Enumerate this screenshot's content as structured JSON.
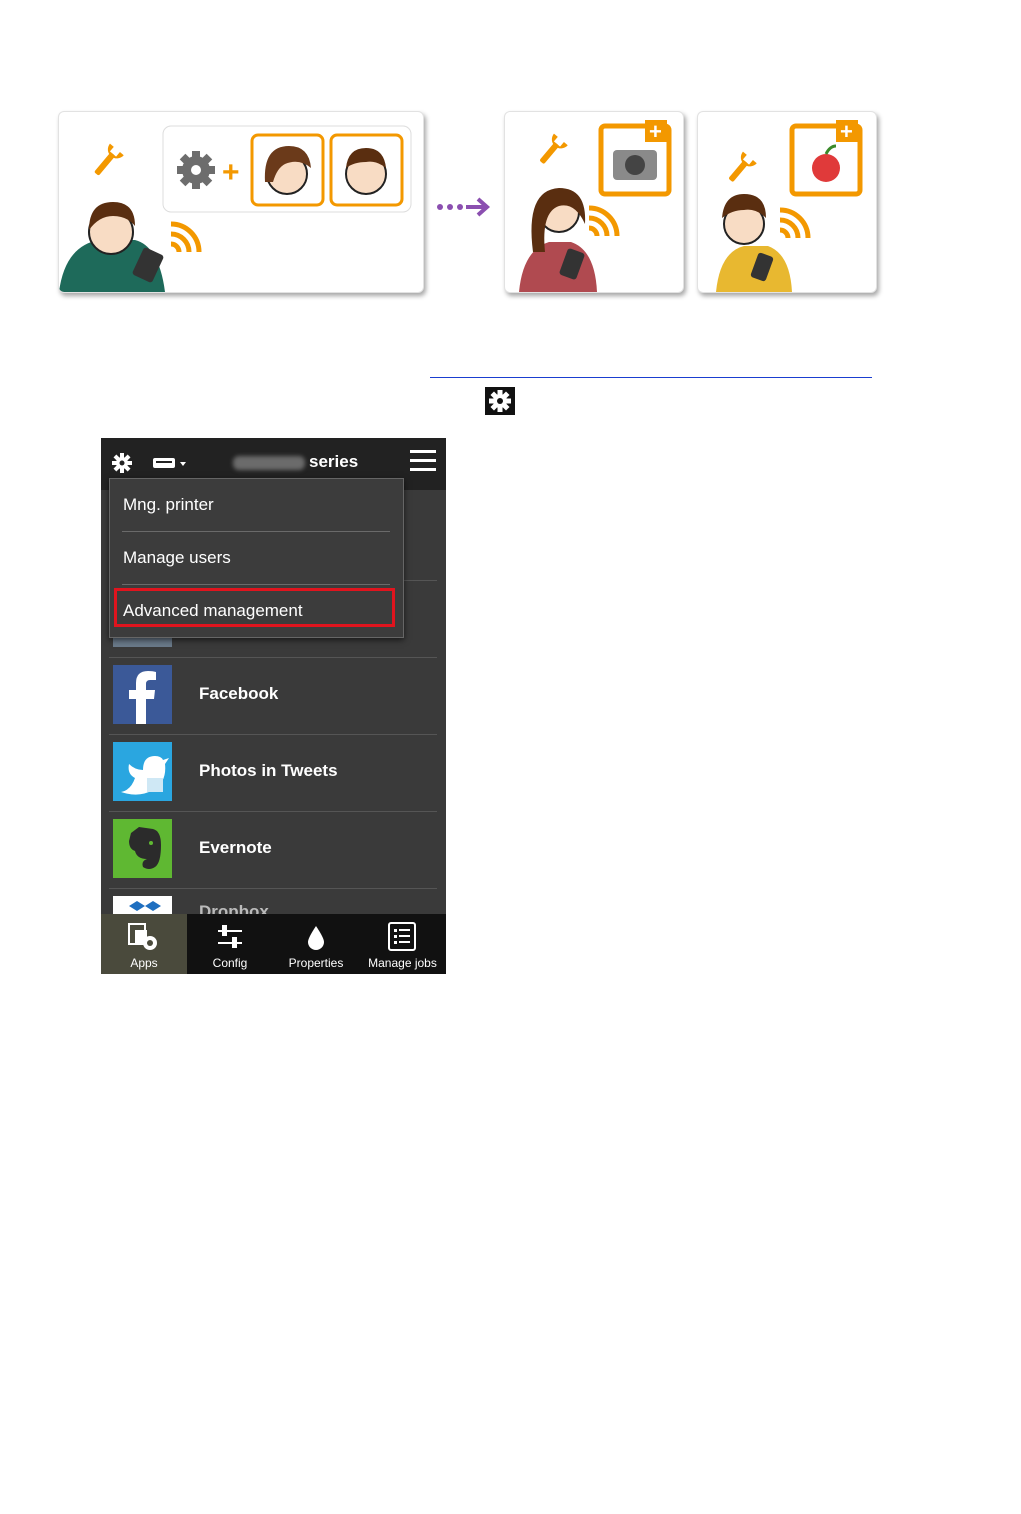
{
  "phone": {
    "header": {
      "title_suffix": "series"
    },
    "dropdown": {
      "items": [
        "Mng. printer",
        "Manage users",
        "Advanced management"
      ],
      "highlighted": "Advanced management",
      "highlight_color": "#e0141e"
    },
    "apps": [
      {
        "name": "Facebook",
        "icon": "facebook-icon"
      },
      {
        "name": "Photos in Tweets",
        "icon": "twitter-photo-icon"
      },
      {
        "name": "Evernote",
        "icon": "evernote-icon"
      },
      {
        "name": "Dropbox",
        "icon": "dropbox-icon"
      }
    ],
    "tabs": [
      {
        "label": "Apps",
        "icon": "apps-icon",
        "active": true
      },
      {
        "label": "Config",
        "icon": "config-sliders-icon"
      },
      {
        "label": "Properties",
        "icon": "ink-drop-icon"
      },
      {
        "label": "Manage jobs",
        "icon": "job-list-icon"
      }
    ]
  },
  "colors": {
    "accent_orange": "#f39800",
    "arrow_purple": "#8b4fb0",
    "link_blue": "#1a3ed0"
  }
}
